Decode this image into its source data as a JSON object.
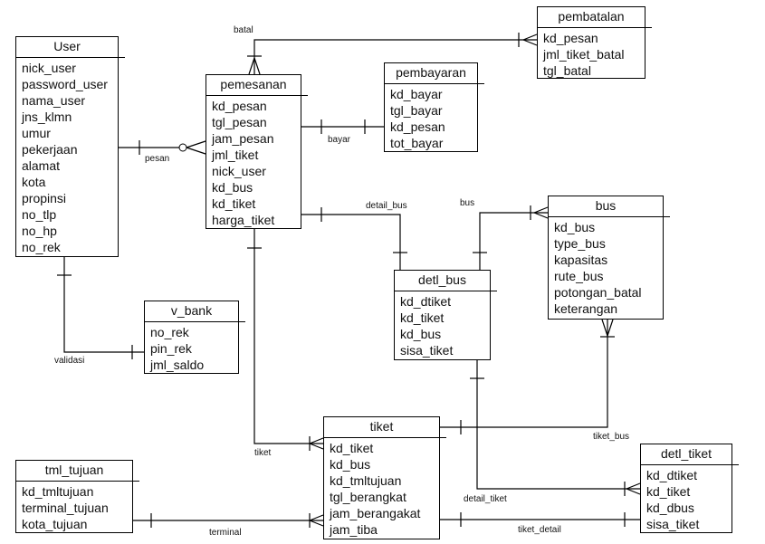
{
  "entities": {
    "user": {
      "name": "User",
      "attributes": [
        "nick_user",
        "password_user",
        "nama_user",
        "jns_klmn",
        "umur",
        "pekerjaan",
        "alamat",
        "kota",
        "propinsi",
        "no_tlp",
        "no_hp",
        "no_rek"
      ]
    },
    "pemesanan": {
      "name": "pemesanan",
      "attributes": [
        "kd_pesan",
        "tgl_pesan",
        "jam_pesan",
        "jml_tiket",
        "nick_user",
        "kd_bus",
        "kd_tiket",
        "harga_tiket"
      ]
    },
    "pembayaran": {
      "name": "pembayaran",
      "attributes": [
        "kd_bayar",
        "tgl_bayar",
        "kd_pesan",
        "tot_bayar"
      ]
    },
    "pembatalan": {
      "name": "pembatalan",
      "attributes": [
        "kd_pesan",
        "jml_tiket_batal",
        "tgl_batal"
      ]
    },
    "bus": {
      "name": "bus",
      "attributes": [
        "kd_bus",
        "type_bus",
        "kapasitas",
        "rute_bus",
        "potongan_batal",
        "keterangan"
      ]
    },
    "detl_bus": {
      "name": "detl_bus",
      "attributes": [
        "kd_dtiket",
        "kd_tiket",
        "kd_bus",
        "sisa_tiket"
      ]
    },
    "v_bank": {
      "name": "v_bank",
      "attributes": [
        "no_rek",
        "pin_rek",
        "jml_saldo"
      ]
    },
    "tiket": {
      "name": "tiket",
      "attributes": [
        "kd_tiket",
        "kd_bus",
        "kd_tmltujuan",
        "tgl_berangkat",
        "jam_berangakat",
        "jam_tiba"
      ]
    },
    "tml_tujuan": {
      "name": "tml_tujuan",
      "attributes": [
        "kd_tmltujuan",
        "terminal_tujuan",
        "kota_tujuan"
      ]
    },
    "detl_tiket": {
      "name": "detl_tiket",
      "attributes": [
        "kd_dtiket",
        "kd_tiket",
        "kd_dbus",
        "sisa_tiket"
      ]
    }
  },
  "relationships": {
    "batal": "batal",
    "bayar": "bayar",
    "pesan": "pesan",
    "detail_bus": "detail_bus",
    "bus": "bus",
    "validasi": "validasi",
    "tiket": "tiket",
    "tiket_bus": "tiket_bus",
    "detail_tiket": "detail_tiket",
    "tiket_detail": "tiket_detail",
    "terminal": "terminal"
  }
}
